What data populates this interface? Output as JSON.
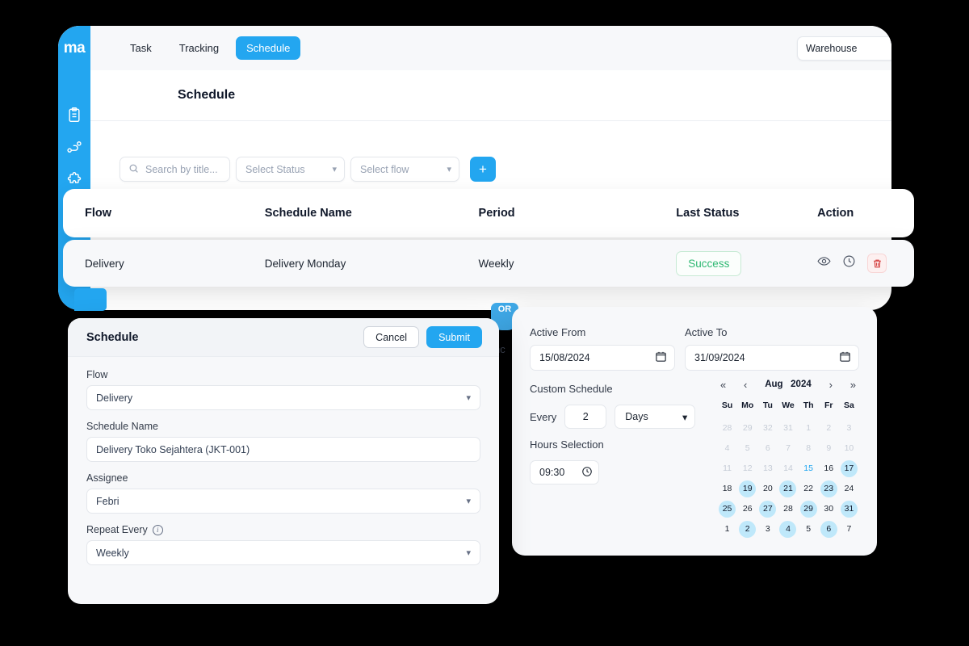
{
  "app": {
    "logo": "ma",
    "nav_tabs": [
      {
        "label": "Task",
        "active": false
      },
      {
        "label": "Tracking",
        "active": false
      },
      {
        "label": "Schedule",
        "active": true
      }
    ],
    "warehouse_selector": {
      "value": "Warehouse",
      "caret": "chevron-down-icon"
    },
    "page_title": "Schedule",
    "sidebar_icons": [
      "clipboard-icon",
      "route-icon",
      "puzzle-icon"
    ]
  },
  "filters": {
    "search_placeholder": "Search by title...",
    "status_placeholder": "Select Status",
    "flow_placeholder": "Select flow",
    "add_label": "+"
  },
  "table": {
    "columns": [
      "Flow",
      "Schedule Name",
      "Period",
      "Last Status",
      "Action"
    ],
    "rows": [
      {
        "flow": "Delivery",
        "schedule_name": "Delivery Monday",
        "period": "Weekly",
        "last_status": "Success",
        "actions": [
          "eye-icon",
          "history-icon",
          "trash-icon"
        ]
      }
    ]
  },
  "decor": {
    "mid_tab_text": "OR",
    "ghost_text": "hc"
  },
  "modal": {
    "title": "Schedule",
    "cancel_label": "Cancel",
    "submit_label": "Submit",
    "fields": {
      "flow_label": "Flow",
      "flow_value": "Delivery",
      "schedule_name_label": "Schedule Name",
      "schedule_name_value": "Delivery Toko Sejahtera (JKT-001)",
      "assignee_label": "Assignee",
      "assignee_value": "Febri",
      "repeat_label": "Repeat Every",
      "repeat_value": "Weekly"
    }
  },
  "right_panel": {
    "active_from_label": "Active From",
    "active_from_value": "15/08/2024",
    "active_to_label": "Active To",
    "active_to_value": "31/09/2024",
    "custom_schedule_label": "Custom Schedule",
    "every_label": "Every",
    "every_value": "2",
    "unit_value": "Days",
    "hours_label": "Hours Selection",
    "hours_value": "09:30",
    "calendar": {
      "month": "Aug",
      "year": "2024",
      "nav": {
        "first": "«",
        "prev": "‹",
        "next": "›",
        "last": "»"
      },
      "dow": [
        "Su",
        "Mo",
        "Tu",
        "We",
        "Th",
        "Fr",
        "Sa"
      ],
      "days": [
        {
          "d": "28",
          "state": "muted"
        },
        {
          "d": "29",
          "state": "muted"
        },
        {
          "d": "32",
          "state": "muted"
        },
        {
          "d": "31",
          "state": "muted"
        },
        {
          "d": "1",
          "state": "muted"
        },
        {
          "d": "2",
          "state": "muted"
        },
        {
          "d": "3",
          "state": "muted"
        },
        {
          "d": "4",
          "state": "muted"
        },
        {
          "d": "5",
          "state": "muted"
        },
        {
          "d": "6",
          "state": "muted"
        },
        {
          "d": "7",
          "state": "muted"
        },
        {
          "d": "8",
          "state": "muted"
        },
        {
          "d": "9",
          "state": "muted"
        },
        {
          "d": "10",
          "state": "muted"
        },
        {
          "d": "11",
          "state": "muted"
        },
        {
          "d": "12",
          "state": "muted"
        },
        {
          "d": "13",
          "state": "muted"
        },
        {
          "d": "14",
          "state": "muted"
        },
        {
          "d": "15",
          "state": "today"
        },
        {
          "d": "16",
          "state": "normal"
        },
        {
          "d": "17",
          "state": "selected"
        },
        {
          "d": "18",
          "state": "normal"
        },
        {
          "d": "19",
          "state": "selected"
        },
        {
          "d": "20",
          "state": "normal"
        },
        {
          "d": "21",
          "state": "selected"
        },
        {
          "d": "22",
          "state": "normal"
        },
        {
          "d": "23",
          "state": "selected"
        },
        {
          "d": "24",
          "state": "normal"
        },
        {
          "d": "25",
          "state": "selected"
        },
        {
          "d": "26",
          "state": "normal"
        },
        {
          "d": "27",
          "state": "selected"
        },
        {
          "d": "28",
          "state": "normal"
        },
        {
          "d": "29",
          "state": "selected"
        },
        {
          "d": "30",
          "state": "normal"
        },
        {
          "d": "31",
          "state": "selected"
        },
        {
          "d": "1",
          "state": "normal"
        },
        {
          "d": "2",
          "state": "selected"
        },
        {
          "d": "3",
          "state": "normal"
        },
        {
          "d": "4",
          "state": "selected"
        },
        {
          "d": "5",
          "state": "normal"
        },
        {
          "d": "6",
          "state": "selected"
        },
        {
          "d": "7",
          "state": "normal"
        }
      ]
    }
  },
  "colors": {
    "brand_blue": "#23a6f0",
    "success_green": "#2db872",
    "danger_red": "#d33b3b",
    "cal_highlight": "#bfe8fa",
    "background": "#000000"
  }
}
